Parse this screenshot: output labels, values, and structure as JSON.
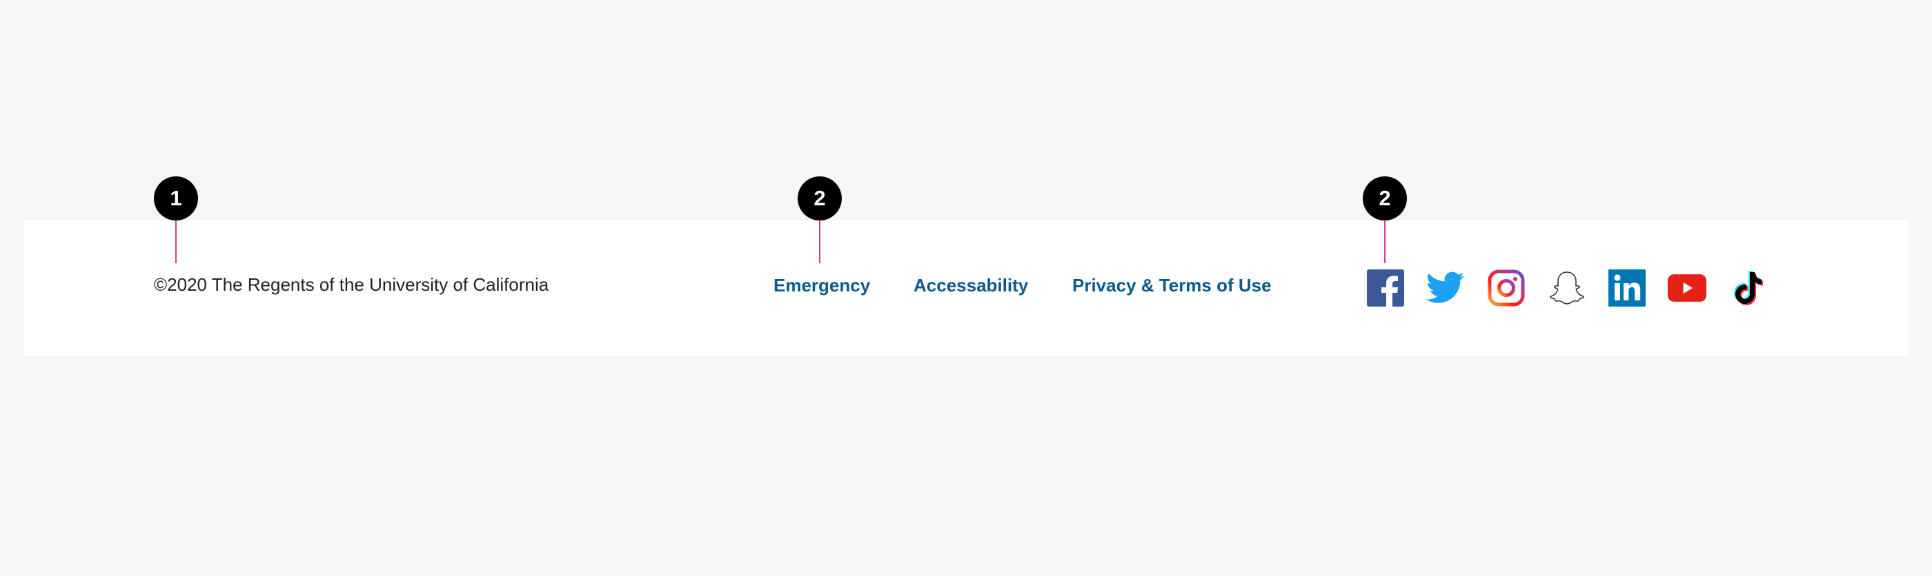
{
  "callouts": [
    {
      "number": "1"
    },
    {
      "number": "2"
    },
    {
      "number": "2"
    }
  ],
  "footer": {
    "copyright": "©2020 The Regents of the University of California",
    "links": [
      {
        "label": "Emergency"
      },
      {
        "label": "Accessability"
      },
      {
        "label": "Privacy & Terms of Use"
      }
    ],
    "social": [
      {
        "icon": "facebook-icon",
        "color": "#3b5998"
      },
      {
        "icon": "twitter-icon",
        "color": "#1da1f2"
      },
      {
        "icon": "instagram-icon",
        "color": "#c13584"
      },
      {
        "icon": "snapchat-icon",
        "color": "#000000"
      },
      {
        "icon": "linkedin-icon",
        "color": "#0077b5"
      },
      {
        "icon": "youtube-icon",
        "color": "#e62117"
      },
      {
        "icon": "tiktok-icon",
        "color": "#000000"
      }
    ]
  },
  "colors": {
    "background": "#f6f6f6",
    "footer_bg": "#ffffff",
    "link": "#0b5a8c",
    "text": "#222222",
    "callout": "#000000",
    "leader": "#d63a8f"
  }
}
